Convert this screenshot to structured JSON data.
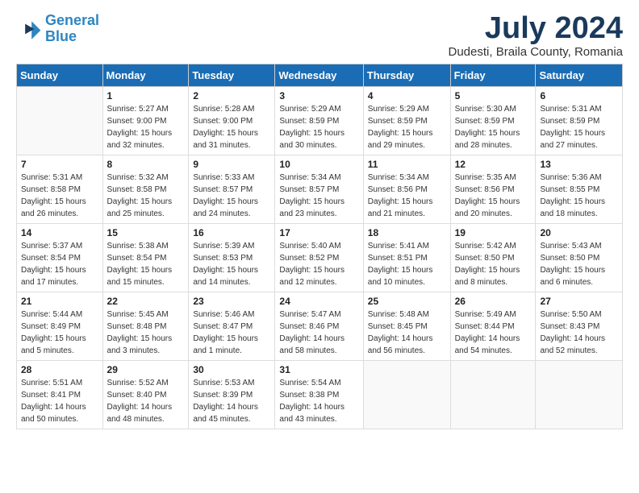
{
  "logo": {
    "line1": "General",
    "line2": "Blue"
  },
  "title": "July 2024",
  "subtitle": "Dudesti, Braila County, Romania",
  "weekdays": [
    "Sunday",
    "Monday",
    "Tuesday",
    "Wednesday",
    "Thursday",
    "Friday",
    "Saturday"
  ],
  "weeks": [
    [
      {
        "day": "",
        "sunrise": "",
        "sunset": "",
        "daylight": ""
      },
      {
        "day": "1",
        "sunrise": "Sunrise: 5:27 AM",
        "sunset": "Sunset: 9:00 PM",
        "daylight": "Daylight: 15 hours and 32 minutes."
      },
      {
        "day": "2",
        "sunrise": "Sunrise: 5:28 AM",
        "sunset": "Sunset: 9:00 PM",
        "daylight": "Daylight: 15 hours and 31 minutes."
      },
      {
        "day": "3",
        "sunrise": "Sunrise: 5:29 AM",
        "sunset": "Sunset: 8:59 PM",
        "daylight": "Daylight: 15 hours and 30 minutes."
      },
      {
        "day": "4",
        "sunrise": "Sunrise: 5:29 AM",
        "sunset": "Sunset: 8:59 PM",
        "daylight": "Daylight: 15 hours and 29 minutes."
      },
      {
        "day": "5",
        "sunrise": "Sunrise: 5:30 AM",
        "sunset": "Sunset: 8:59 PM",
        "daylight": "Daylight: 15 hours and 28 minutes."
      },
      {
        "day": "6",
        "sunrise": "Sunrise: 5:31 AM",
        "sunset": "Sunset: 8:59 PM",
        "daylight": "Daylight: 15 hours and 27 minutes."
      }
    ],
    [
      {
        "day": "7",
        "sunrise": "Sunrise: 5:31 AM",
        "sunset": "Sunset: 8:58 PM",
        "daylight": "Daylight: 15 hours and 26 minutes."
      },
      {
        "day": "8",
        "sunrise": "Sunrise: 5:32 AM",
        "sunset": "Sunset: 8:58 PM",
        "daylight": "Daylight: 15 hours and 25 minutes."
      },
      {
        "day": "9",
        "sunrise": "Sunrise: 5:33 AM",
        "sunset": "Sunset: 8:57 PM",
        "daylight": "Daylight: 15 hours and 24 minutes."
      },
      {
        "day": "10",
        "sunrise": "Sunrise: 5:34 AM",
        "sunset": "Sunset: 8:57 PM",
        "daylight": "Daylight: 15 hours and 23 minutes."
      },
      {
        "day": "11",
        "sunrise": "Sunrise: 5:34 AM",
        "sunset": "Sunset: 8:56 PM",
        "daylight": "Daylight: 15 hours and 21 minutes."
      },
      {
        "day": "12",
        "sunrise": "Sunrise: 5:35 AM",
        "sunset": "Sunset: 8:56 PM",
        "daylight": "Daylight: 15 hours and 20 minutes."
      },
      {
        "day": "13",
        "sunrise": "Sunrise: 5:36 AM",
        "sunset": "Sunset: 8:55 PM",
        "daylight": "Daylight: 15 hours and 18 minutes."
      }
    ],
    [
      {
        "day": "14",
        "sunrise": "Sunrise: 5:37 AM",
        "sunset": "Sunset: 8:54 PM",
        "daylight": "Daylight: 15 hours and 17 minutes."
      },
      {
        "day": "15",
        "sunrise": "Sunrise: 5:38 AM",
        "sunset": "Sunset: 8:54 PM",
        "daylight": "Daylight: 15 hours and 15 minutes."
      },
      {
        "day": "16",
        "sunrise": "Sunrise: 5:39 AM",
        "sunset": "Sunset: 8:53 PM",
        "daylight": "Daylight: 15 hours and 14 minutes."
      },
      {
        "day": "17",
        "sunrise": "Sunrise: 5:40 AM",
        "sunset": "Sunset: 8:52 PM",
        "daylight": "Daylight: 15 hours and 12 minutes."
      },
      {
        "day": "18",
        "sunrise": "Sunrise: 5:41 AM",
        "sunset": "Sunset: 8:51 PM",
        "daylight": "Daylight: 15 hours and 10 minutes."
      },
      {
        "day": "19",
        "sunrise": "Sunrise: 5:42 AM",
        "sunset": "Sunset: 8:50 PM",
        "daylight": "Daylight: 15 hours and 8 minutes."
      },
      {
        "day": "20",
        "sunrise": "Sunrise: 5:43 AM",
        "sunset": "Sunset: 8:50 PM",
        "daylight": "Daylight: 15 hours and 6 minutes."
      }
    ],
    [
      {
        "day": "21",
        "sunrise": "Sunrise: 5:44 AM",
        "sunset": "Sunset: 8:49 PM",
        "daylight": "Daylight: 15 hours and 5 minutes."
      },
      {
        "day": "22",
        "sunrise": "Sunrise: 5:45 AM",
        "sunset": "Sunset: 8:48 PM",
        "daylight": "Daylight: 15 hours and 3 minutes."
      },
      {
        "day": "23",
        "sunrise": "Sunrise: 5:46 AM",
        "sunset": "Sunset: 8:47 PM",
        "daylight": "Daylight: 15 hours and 1 minute."
      },
      {
        "day": "24",
        "sunrise": "Sunrise: 5:47 AM",
        "sunset": "Sunset: 8:46 PM",
        "daylight": "Daylight: 14 hours and 58 minutes."
      },
      {
        "day": "25",
        "sunrise": "Sunrise: 5:48 AM",
        "sunset": "Sunset: 8:45 PM",
        "daylight": "Daylight: 14 hours and 56 minutes."
      },
      {
        "day": "26",
        "sunrise": "Sunrise: 5:49 AM",
        "sunset": "Sunset: 8:44 PM",
        "daylight": "Daylight: 14 hours and 54 minutes."
      },
      {
        "day": "27",
        "sunrise": "Sunrise: 5:50 AM",
        "sunset": "Sunset: 8:43 PM",
        "daylight": "Daylight: 14 hours and 52 minutes."
      }
    ],
    [
      {
        "day": "28",
        "sunrise": "Sunrise: 5:51 AM",
        "sunset": "Sunset: 8:41 PM",
        "daylight": "Daylight: 14 hours and 50 minutes."
      },
      {
        "day": "29",
        "sunrise": "Sunrise: 5:52 AM",
        "sunset": "Sunset: 8:40 PM",
        "daylight": "Daylight: 14 hours and 48 minutes."
      },
      {
        "day": "30",
        "sunrise": "Sunrise: 5:53 AM",
        "sunset": "Sunset: 8:39 PM",
        "daylight": "Daylight: 14 hours and 45 minutes."
      },
      {
        "day": "31",
        "sunrise": "Sunrise: 5:54 AM",
        "sunset": "Sunset: 8:38 PM",
        "daylight": "Daylight: 14 hours and 43 minutes."
      },
      {
        "day": "",
        "sunrise": "",
        "sunset": "",
        "daylight": ""
      },
      {
        "day": "",
        "sunrise": "",
        "sunset": "",
        "daylight": ""
      },
      {
        "day": "",
        "sunrise": "",
        "sunset": "",
        "daylight": ""
      }
    ]
  ]
}
